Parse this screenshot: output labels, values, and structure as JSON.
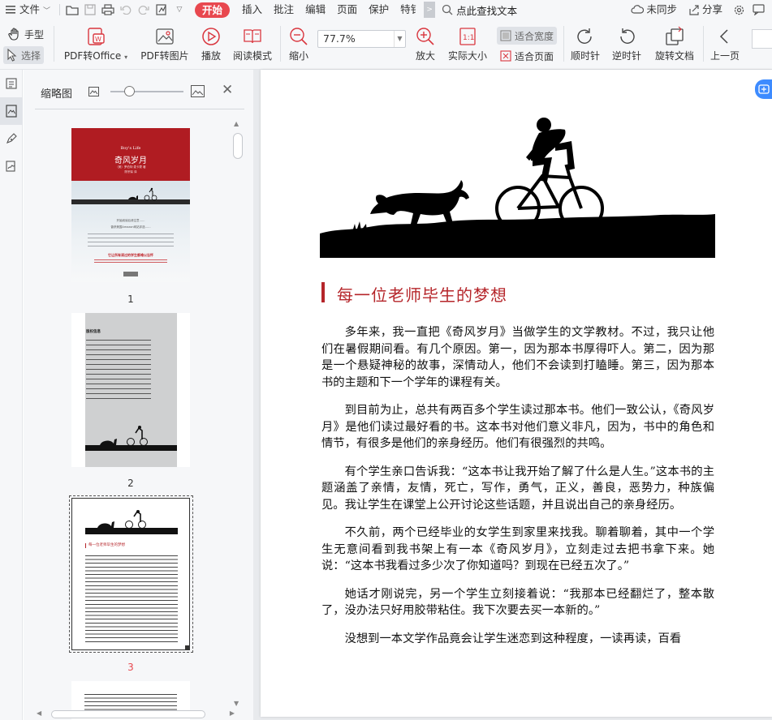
{
  "menu": {
    "file": "文件",
    "start": "开始",
    "insert": "插入",
    "annotate": "批注",
    "edit": "编辑",
    "page": "页面",
    "protect": "保护",
    "special": "特钅",
    "search_placeholder": "点此查找文本",
    "sync": "未同步",
    "share": "分享"
  },
  "toolbar": {
    "hand": "手型",
    "select": "选择",
    "pdf_to_office": "PDF转Office",
    "pdf_to_image": "PDF转图片",
    "play": "播放",
    "read_mode": "阅读模式",
    "zoom_out": "缩小",
    "zoom_value": "77.7%",
    "zoom_in": "放大",
    "actual_size": "实际大小",
    "fit_width": "适合宽度",
    "fit_page": "适合页面",
    "clockwise": "顺时针",
    "counter_clockwise": "逆时针",
    "rotate_doc": "旋转文档",
    "prev_page": "上一页"
  },
  "thumbnails": {
    "title": "缩略图",
    "pages": [
      {
        "number": "1"
      },
      {
        "number": "2"
      },
      {
        "number": "3"
      }
    ],
    "cover": {
      "series": "Boy's Life",
      "title": "奇风岁月",
      "author": "（美）罗伯特·麦卡蒙 著",
      "translator": "陈宗琛 译",
      "blurb_1": "开始阅读后请注意……",
      "blurb_2": "曾获美国Amazon网站评选……",
      "promo": "它让所有读过的学生都难以忘怀"
    },
    "page2_heading": "版权信息"
  },
  "document": {
    "heading": "每一位老师毕生的梦想",
    "paragraphs": [
      "多年来，我一直把《奇风岁月》当做学生的文学教材。不过，我只让他们在暑假期间看。有几个原因。第一，因为那本书厚得吓人。第二，因为那是一个悬疑神秘的故事，深情动人，他们不会读到打瞌睡。第三，因为那本书的主题和下一个学年的课程有关。",
      "到目前为止，总共有两百多个学生读过那本书。他们一致公认，《奇风岁月》是他们读过最好看的书。这本书对他们意义非凡，因为，书中的角色和情节，有很多是他们的亲身经历。他们有很强烈的共鸣。",
      "有个学生亲口告诉我：“这本书让我开始了解了什么是人生。”这本书的主题涵盖了亲情，友情，死亡，写作，勇气，正义，善良，恶势力，种族偏见。我让学生在课堂上公开讨论这些话题，并且说出自己的亲身经历。",
      "不久前，两个已经毕业的女学生到家里来找我。聊着聊着，其中一个学生无意间看到我书架上有一本《奇风岁月》，立刻走过去把书拿下来。她说：“这本书我看过多少次了你知道吗？到现在已经五次了。”",
      "她话才刚说完，另一个学生立刻接着说：“我那本已经翻烂了，整本散了，没办法只好用胶带粘住。我下次要去买一本新的。”",
      "没想到一本文学作品竟会让学生迷恋到这种程度，一读再读，百看"
    ]
  },
  "colors": {
    "accent": "#e8484f",
    "heading": "#b5252a",
    "cover_red": "#b01c22"
  }
}
